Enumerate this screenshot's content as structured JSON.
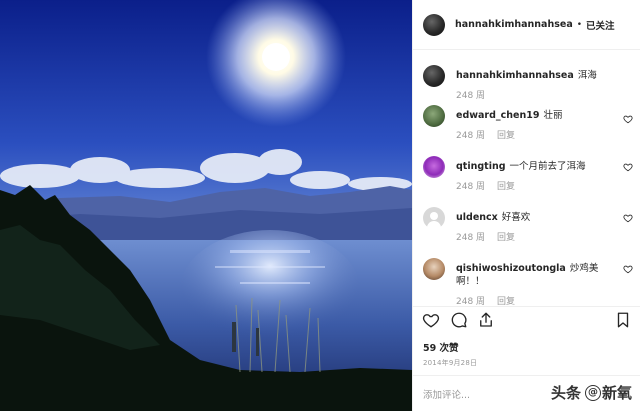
{
  "post": {
    "author": "hannahkimhannahsea",
    "follow_status": "已关注",
    "separator": "•"
  },
  "caption": {
    "user": "hannahkimhannahsea",
    "text": "洱海",
    "age": "248 周"
  },
  "comments": [
    {
      "user": "edward_chen19",
      "text": "壮丽",
      "age": "248 周",
      "reply": "回复"
    },
    {
      "user": "qtingting",
      "text": "一个月前去了洱海",
      "age": "248 周",
      "reply": "回复"
    },
    {
      "user": "uldencx",
      "text": "好喜欢",
      "age": "248 周",
      "reply": "回复"
    },
    {
      "user": "qishiwoshizoutongla",
      "text": "炒鸡美啊！！",
      "age": "248 周",
      "reply": "回复"
    }
  ],
  "stats": {
    "likes": "59 次赞",
    "date": "2014年9月28日"
  },
  "add_comment": {
    "placeholder": "添加评论..."
  },
  "watermark": {
    "prefix": "头条",
    "badge": "@",
    "name": "新氧"
  },
  "icons": {
    "like": "heart-outline-icon",
    "comment": "speech-bubble-icon",
    "share": "share-upload-icon",
    "save": "bookmark-icon",
    "comment_like": "small-heart-icon"
  },
  "colors": {
    "text": "#262626",
    "muted": "#999999",
    "divider": "#efefef"
  }
}
